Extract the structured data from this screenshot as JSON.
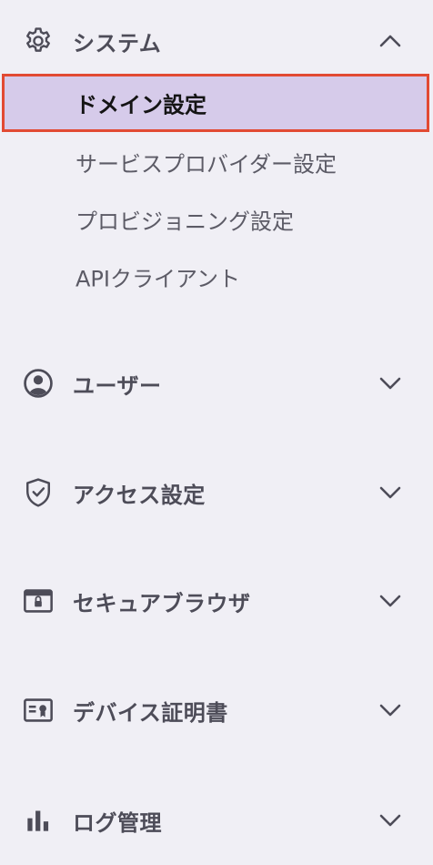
{
  "sidebar": {
    "system": {
      "label": "システム",
      "icon": "gear-icon",
      "expanded": true,
      "items": [
        {
          "label": "ドメイン設定",
          "selected": true
        },
        {
          "label": "サービスプロバイダー設定",
          "selected": false
        },
        {
          "label": "プロビジョニング設定",
          "selected": false
        },
        {
          "label": "APIクライアント",
          "selected": false
        }
      ]
    },
    "users": {
      "label": "ユーザー",
      "icon": "user-circle-icon",
      "expanded": false
    },
    "access": {
      "label": "アクセス設定",
      "icon": "shield-check-icon",
      "expanded": false
    },
    "secure_browser": {
      "label": "セキュアブラウザ",
      "icon": "browser-lock-icon",
      "expanded": false
    },
    "device_cert": {
      "label": "デバイス証明書",
      "icon": "certificate-icon",
      "expanded": false
    },
    "logs": {
      "label": "ログ管理",
      "icon": "bar-chart-icon",
      "expanded": false
    }
  },
  "colors": {
    "background": "#f0eff5",
    "selected_background": "#d6cbea",
    "selected_border": "#e24a33",
    "text": "#4d4c58",
    "selected_text": "#141414"
  }
}
